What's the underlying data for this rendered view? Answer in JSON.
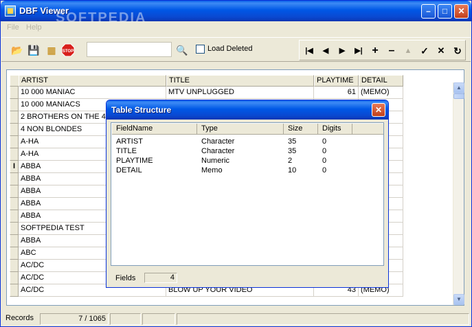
{
  "window": {
    "title": "DBF Viewer",
    "watermark": "SOFTPEDIA"
  },
  "menu": [
    "File",
    "Help"
  ],
  "toolbar": {
    "search_value": "",
    "load_deleted_label": "Load Deleted",
    "load_deleted_checked": false,
    "stop_label": "STOP"
  },
  "grid": {
    "columns": [
      "ARTIST",
      "TITLE",
      "PLAYTIME",
      "DETAIL"
    ],
    "rows": [
      {
        "artist": "10 000 MANIAC",
        "title": "MTV UNPLUGGED",
        "playtime": "61",
        "detail": "(MEMO)"
      },
      {
        "artist": "10 000 MANIACS",
        "title": "",
        "playtime": "",
        "detail": ""
      },
      {
        "artist": "2 BROTHERS ON THE 4T",
        "title": "",
        "playtime": "",
        "detail": ""
      },
      {
        "artist": "4 NON BLONDES",
        "title": "",
        "playtime": "",
        "detail": ""
      },
      {
        "artist": "A-HA",
        "title": "",
        "playtime": "",
        "detail": ""
      },
      {
        "artist": "A-HA",
        "title": "",
        "playtime": "",
        "detail": ""
      },
      {
        "artist": "ABBA",
        "title": "",
        "playtime": "",
        "detail": ""
      },
      {
        "artist": "ABBA",
        "title": "",
        "playtime": "",
        "detail": ""
      },
      {
        "artist": "ABBA",
        "title": "",
        "playtime": "",
        "detail": ""
      },
      {
        "artist": "ABBA",
        "title": "",
        "playtime": "",
        "detail": ""
      },
      {
        "artist": "ABBA",
        "title": "",
        "playtime": "",
        "detail": ""
      },
      {
        "artist": "SOFTPEDIA TEST",
        "title": "",
        "playtime": "",
        "detail": ""
      },
      {
        "artist": "ABBA",
        "title": "",
        "playtime": "",
        "detail": ""
      },
      {
        "artist": "ABC",
        "title": "",
        "playtime": "",
        "detail": ""
      },
      {
        "artist": "AC/DC",
        "title": "",
        "playtime": "",
        "detail": ""
      },
      {
        "artist": "AC/DC",
        "title": "",
        "playtime": "",
        "detail": ""
      },
      {
        "artist": "AC/DC",
        "title": "BLOW UP YOUR VIDEO",
        "playtime": "43",
        "detail": "(MEMO)"
      }
    ],
    "current_row_marker": "I"
  },
  "status": {
    "label": "Records",
    "position": "7 / 1065"
  },
  "dialog": {
    "title": "Table Structure",
    "columns": [
      "FieldName",
      "Type",
      "Size",
      "Digits"
    ],
    "fields": [
      {
        "name": "ARTIST",
        "type": "Character",
        "size": "35",
        "digits": "0"
      },
      {
        "name": "TITLE",
        "type": "Character",
        "size": "35",
        "digits": "0"
      },
      {
        "name": "PLAYTIME",
        "type": "Numeric",
        "size": "2",
        "digits": "0"
      },
      {
        "name": "DETAIL",
        "type": "Memo",
        "size": "10",
        "digits": "0"
      }
    ],
    "fields_label": "Fields",
    "fields_count": "4"
  },
  "icons": {
    "open": "folder-open-icon",
    "save": "save-icon",
    "structure": "table-structure-icon",
    "stop": "stop-icon",
    "search": "search-icon",
    "first": "first-record-icon",
    "prior": "prior-record-icon",
    "next": "next-record-icon",
    "last": "last-record-icon",
    "insert": "insert-icon",
    "delete": "delete-icon",
    "edit": "edit-icon",
    "post": "post-icon",
    "cancel": "cancel-icon",
    "refresh": "refresh-icon"
  }
}
